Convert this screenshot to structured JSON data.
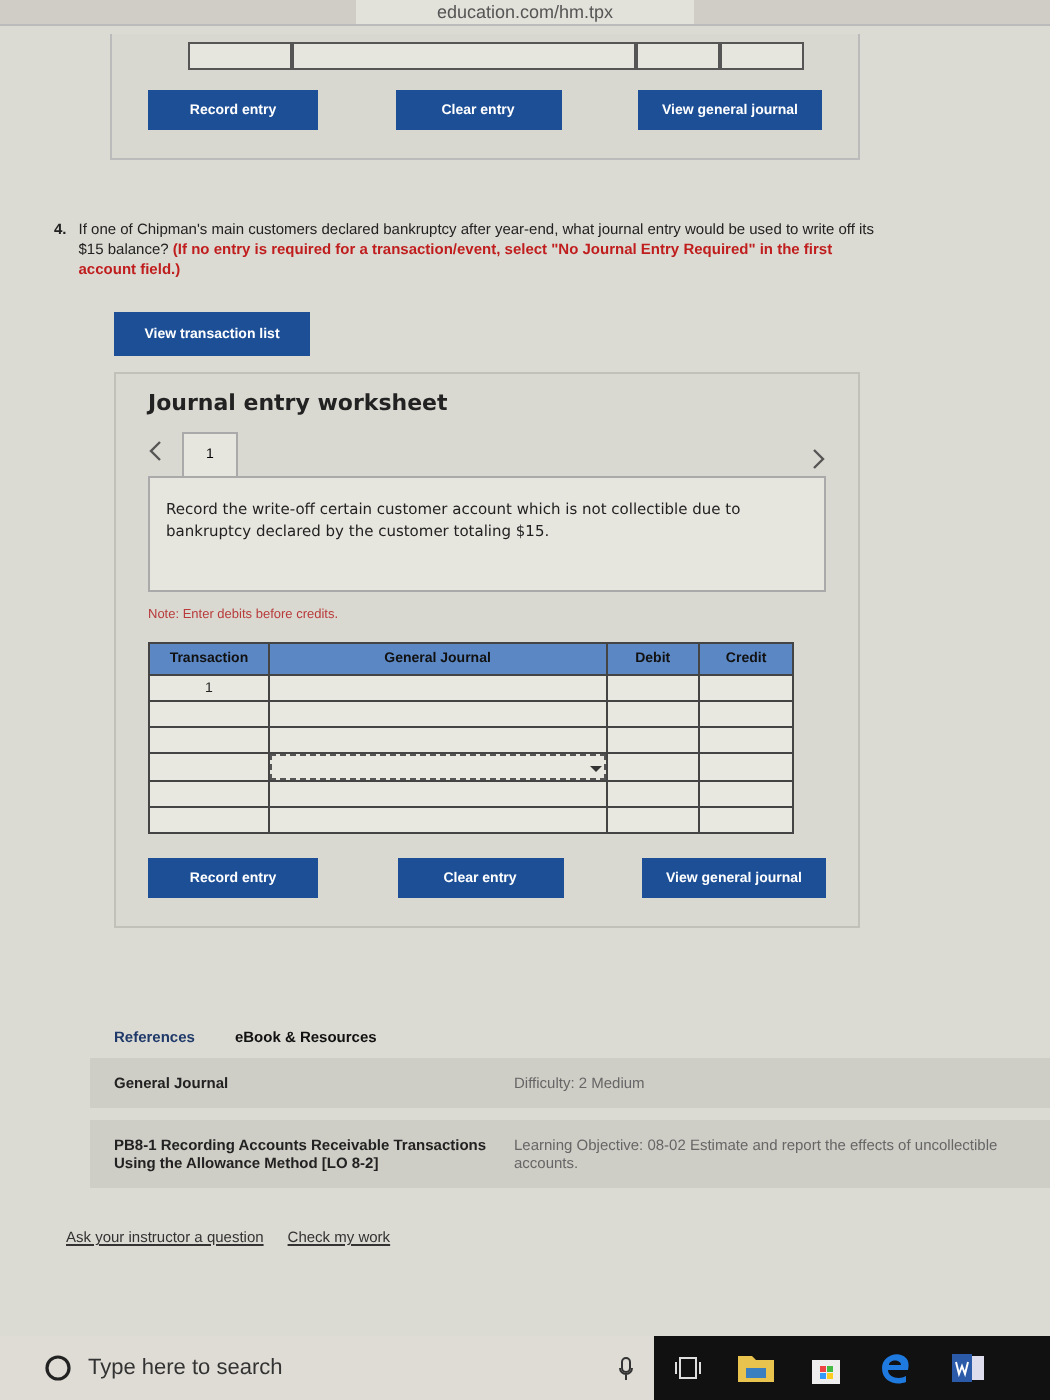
{
  "browser": {
    "url": "education.com/hm.tpx"
  },
  "previous_worksheet": {
    "buttons": [
      "Record entry",
      "Clear entry",
      "View general journal"
    ]
  },
  "question": {
    "number": "4.",
    "text": "If one of Chipman's main customers declared bankruptcy after year-end, what journal entry would be used to write off its $15 balance?",
    "instruction": "(If no entry is required for a transaction/event, select \"No Journal Entry Required\" in the first account field.)"
  },
  "view_transaction_list": "View transaction list",
  "worksheet": {
    "title": "Journal entry worksheet",
    "tabs": [
      {
        "label": "1",
        "selected": true
      }
    ],
    "description": "Record the write-off certain customer account which is not collectible due to bankruptcy declared by the customer totaling $15.",
    "note": "Note: Enter debits before credits.",
    "table": {
      "columns": [
        "Transaction",
        "General Journal",
        "Debit",
        "Credit"
      ],
      "rows": [
        {
          "transaction": "1",
          "kind": "text"
        },
        {
          "kind": "text"
        },
        {
          "kind": "text"
        },
        {
          "kind": "dropdown"
        },
        {
          "kind": "text"
        },
        {
          "kind": "text"
        }
      ]
    },
    "buttons": [
      "Record entry",
      "Clear entry",
      "View general journal"
    ]
  },
  "references": {
    "tabs": [
      {
        "label": "References",
        "selected": true
      },
      {
        "label": "eBook & Resources",
        "selected": false
      }
    ],
    "rows": [
      {
        "label": "General Journal",
        "value": "Difficulty: 2 Medium"
      },
      {
        "label": "PB8-1 Recording Accounts Receivable Transactions Using the Allowance Method [LO 8-2]",
        "value": "Learning Objective: 08-02 Estimate and report the effects of uncollectible accounts."
      }
    ]
  },
  "links": [
    "Ask your instructor a question",
    "Check my work"
  ],
  "taskbar": {
    "search_placeholder": "Type here to search"
  }
}
